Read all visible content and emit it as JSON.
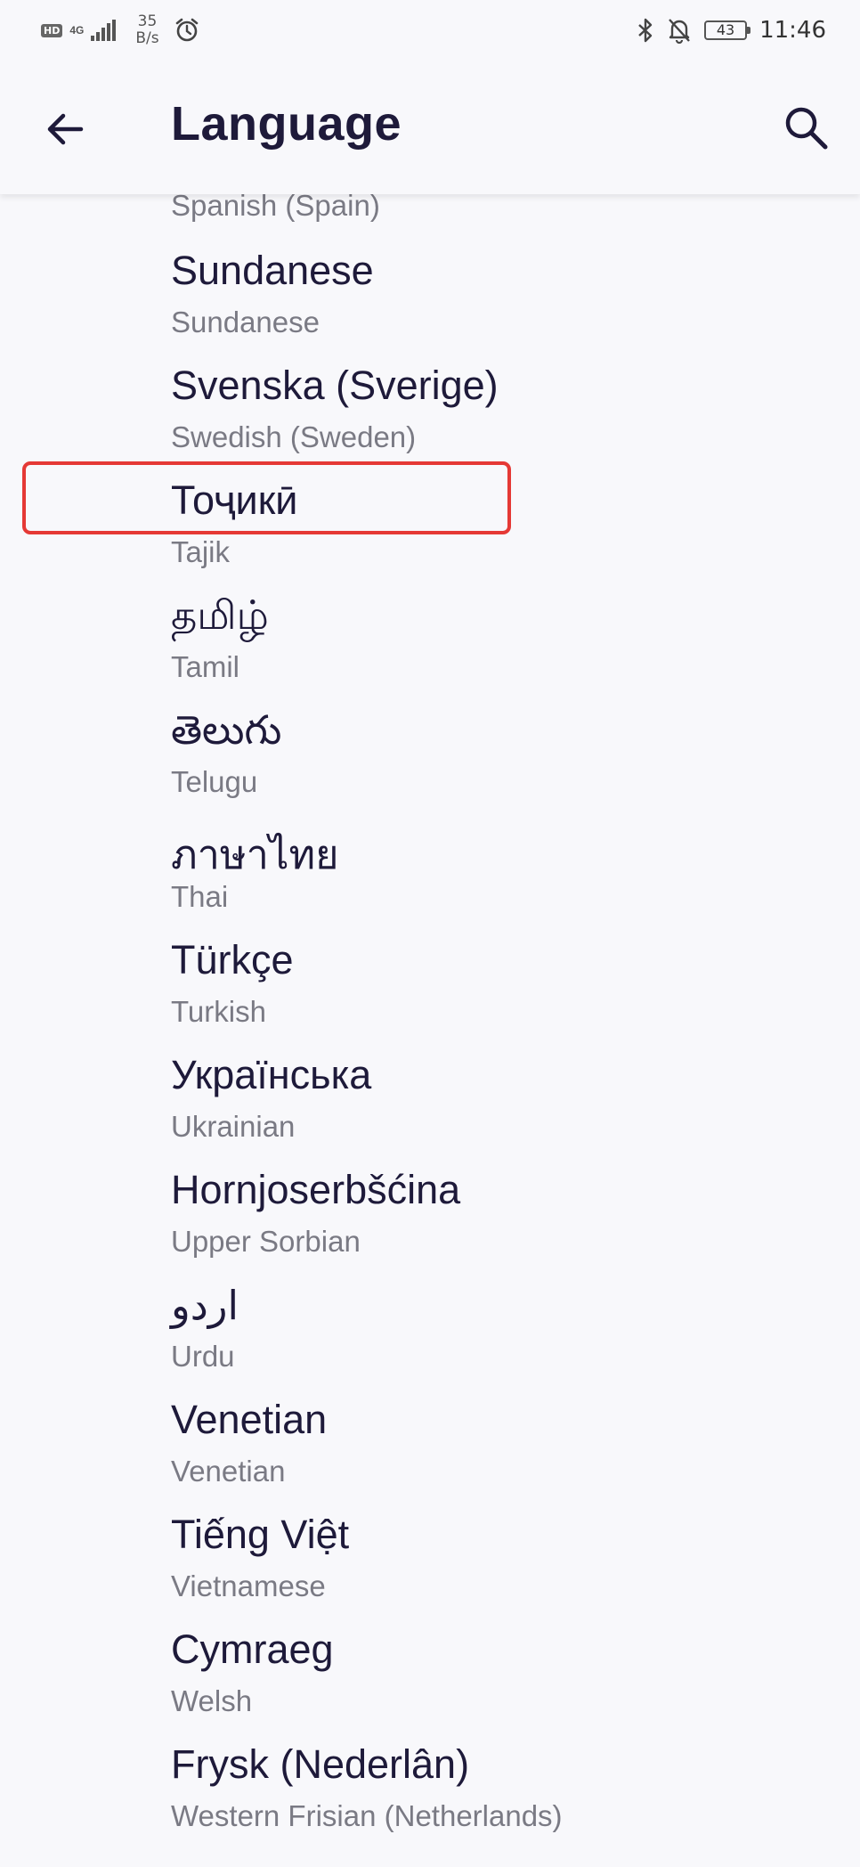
{
  "status_bar": {
    "hd": "HD",
    "network": "4G",
    "speed_value": "35",
    "speed_unit": "B/s",
    "battery": "43",
    "time": "11:46"
  },
  "app_bar": {
    "title": "Language"
  },
  "languages": [
    {
      "native": "",
      "english": "Spanish (Spain)"
    },
    {
      "native": "Sundanese",
      "english": "Sundanese"
    },
    {
      "native": "Svenska (Sverige)",
      "english": "Swedish (Sweden)"
    },
    {
      "native": "Тоҷикӣ",
      "english": "Tajik"
    },
    {
      "native": "தமிழ்",
      "english": "Tamil"
    },
    {
      "native": "తెలుగు",
      "english": "Telugu"
    },
    {
      "native": "ภาษาไทย",
      "english": "Thai"
    },
    {
      "native": "Türkçe",
      "english": "Turkish"
    },
    {
      "native": "Українська",
      "english": "Ukrainian"
    },
    {
      "native": "Hornjoserbšćina",
      "english": "Upper Sorbian"
    },
    {
      "native": "اردو",
      "english": "Urdu"
    },
    {
      "native": "Venetian",
      "english": "Venetian"
    },
    {
      "native": "Tiếng Việt",
      "english": "Vietnamese"
    },
    {
      "native": "Cymraeg",
      "english": "Welsh"
    },
    {
      "native": "Frysk (Nederlân)",
      "english": "Western Frisian (Netherlands)"
    }
  ],
  "colors": {
    "background": "#f8f8fb",
    "primary_text": "#1e1a3a",
    "secondary_text": "#7a7a84",
    "highlight": "#e53935"
  },
  "icons": [
    "back-arrow-icon",
    "search-icon",
    "bluetooth-icon",
    "bell-off-icon",
    "alarm-icon",
    "signal-icon",
    "battery-icon"
  ]
}
